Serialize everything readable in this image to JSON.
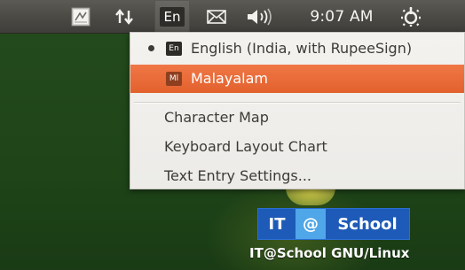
{
  "panel": {
    "keyboard_indicator": "En",
    "clock": "9:07 AM",
    "icons": {
      "app": "app-launcher-icon",
      "network": "network-updown-icon",
      "messages": "envelope-icon",
      "sound": "speaker-icon",
      "session": "gear-power-icon"
    }
  },
  "keyboard_menu": {
    "items": [
      {
        "label": "English (India, with RupeeSign)",
        "icon_text": "En",
        "selected": true
      },
      {
        "label": "Malayalam",
        "icon_text": "Ml",
        "highlighted": true
      }
    ],
    "actions": [
      {
        "label": "Character Map"
      },
      {
        "label": "Keyboard Layout Chart"
      },
      {
        "label": "Text Entry Settings..."
      }
    ]
  },
  "background": {
    "logo": {
      "it": "IT",
      "at": "@",
      "school": "School"
    },
    "caption": "IT@School GNU/Linux"
  },
  "colors": {
    "panel_bg": "#4a4944",
    "menu_bg": "#f2f1ee",
    "highlight": "#e8683a",
    "desktop_bg": "#1e4418",
    "logo_blue": "#1e5bb8",
    "logo_light_blue": "#4fa6e8"
  }
}
